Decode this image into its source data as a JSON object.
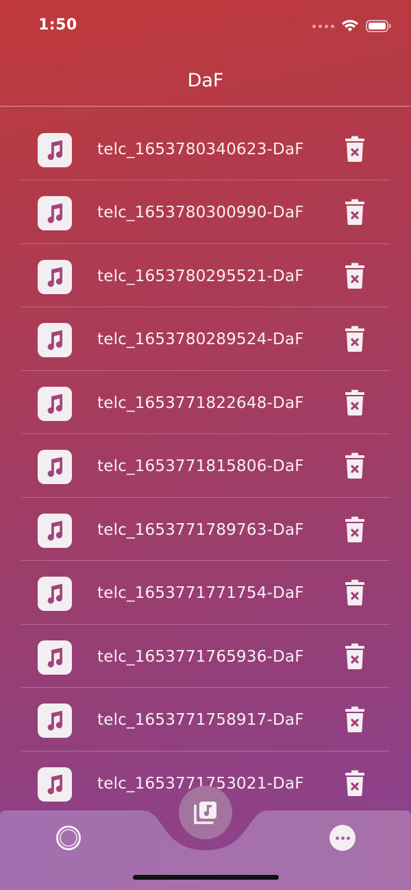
{
  "status_bar": {
    "time": "1:50"
  },
  "header": {
    "title": "DaF"
  },
  "recordings": [
    {
      "name": "telc_1653780340623-DaF"
    },
    {
      "name": "telc_1653780300990-DaF"
    },
    {
      "name": "telc_1653780295521-DaF"
    },
    {
      "name": "telc_1653780289524-DaF"
    },
    {
      "name": "telc_1653771822648-DaF"
    },
    {
      "name": "telc_1653771815806-DaF"
    },
    {
      "name": "telc_1653771789763-DaF"
    },
    {
      "name": "telc_1653771771754-DaF"
    },
    {
      "name": "telc_1653771765936-DaF"
    },
    {
      "name": "telc_1653771758917-DaF"
    },
    {
      "name": "telc_1653771753021-DaF"
    }
  ],
  "icons": {
    "row_icon": "music-note-icon",
    "row_action": "trash-delete-icon",
    "nav_left": "record-icon",
    "nav_center": "music-library-icon",
    "nav_right": "more-options-icon"
  },
  "colors": {
    "gradient_top": "#c0393a",
    "gradient_bottom": "#8b4393",
    "icon_tile": "#f3eef1",
    "icon_glyph": "#a3447a",
    "bottom_bar": "#a66fae",
    "fab": "#a3749e"
  }
}
